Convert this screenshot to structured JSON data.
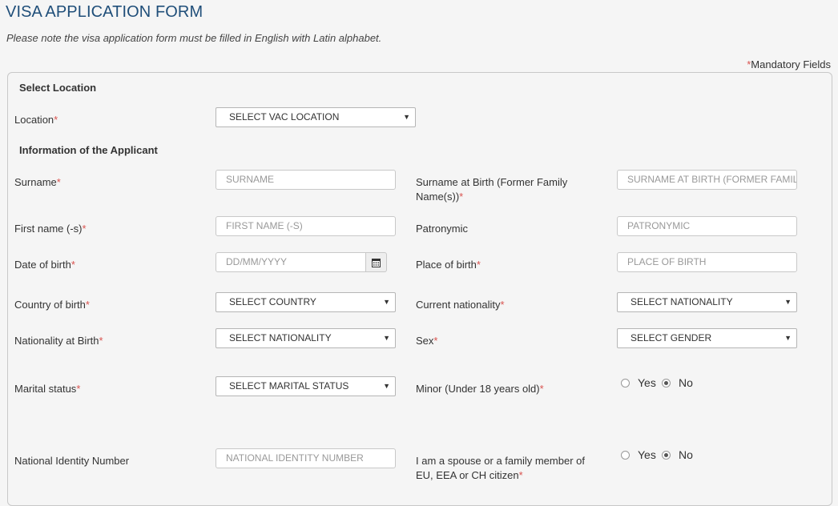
{
  "header": {
    "title": "VISA APPLICATION FORM",
    "note": "Please note the visa application form must be filled in English with Latin alphabet.",
    "mandatory_star": "*",
    "mandatory_text": "Mandatory Fields"
  },
  "sections": {
    "location": "Select Location",
    "applicant": "Information of the Applicant"
  },
  "fields": {
    "location": {
      "label": "Location",
      "value": "SELECT VAC LOCATION"
    },
    "surname": {
      "label": "Surname",
      "placeholder": "SURNAME"
    },
    "surname_birth": {
      "label_line1": "Surname at Birth (Former Family",
      "label_line2": "Name(s))",
      "placeholder": "SURNAME AT BIRTH (FORMER FAMILY NAME(S))"
    },
    "first_name": {
      "label": "First name (-s)",
      "placeholder": "FIRST NAME (-S)"
    },
    "patronymic": {
      "label": "Patronymic",
      "placeholder": "PATRONYMIC"
    },
    "dob": {
      "label": "Date of birth",
      "placeholder": "DD/MM/YYYY"
    },
    "place_of_birth": {
      "label": "Place of birth",
      "placeholder": "PLACE OF BIRTH"
    },
    "country_of_birth": {
      "label": "Country of birth",
      "value": "SELECT COUNTRY"
    },
    "current_nationality": {
      "label": "Current nationality",
      "value": "SELECT NATIONALITY"
    },
    "nationality_at_birth": {
      "label": "Nationality at Birth",
      "value": "SELECT NATIONALITY"
    },
    "sex": {
      "label": "Sex",
      "value": "SELECT GENDER"
    },
    "marital_status": {
      "label": "Marital status",
      "value": "SELECT MARITAL STATUS"
    },
    "minor": {
      "label": "Minor (Under 18 years old)",
      "yes": "Yes",
      "no": "No",
      "selected": "No"
    },
    "national_id": {
      "label": "National Identity Number",
      "placeholder": "NATIONAL IDENTITY NUMBER"
    },
    "eu_family": {
      "label_line1": "I am a spouse or a family member of",
      "label_line2": "EU, EEA or CH citizen",
      "yes": "Yes",
      "no": "No",
      "selected": "No"
    }
  },
  "required_mark": "*",
  "icons": {
    "calendar": "calendar-icon",
    "caret": "caret-down-icon"
  },
  "colors": {
    "title": "#1f4e79",
    "required": "#d9534f"
  }
}
